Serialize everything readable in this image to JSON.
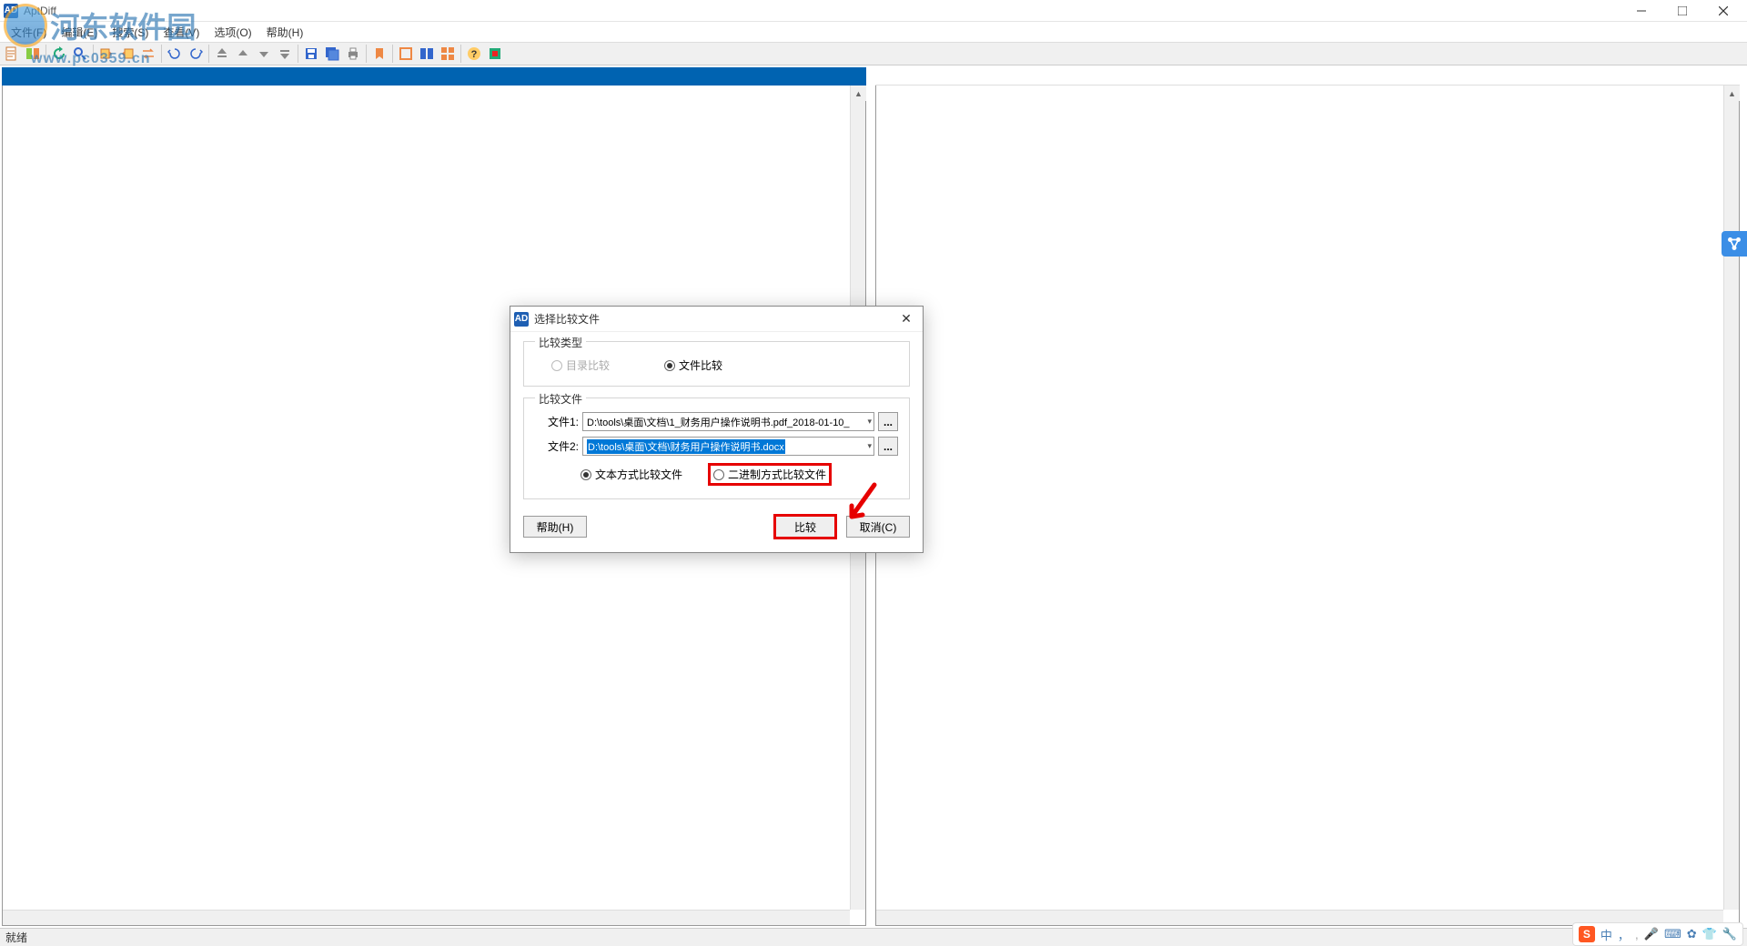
{
  "app": {
    "title": "AptDiff"
  },
  "watermark": {
    "text": "河东软件园",
    "url": "www.pc0359.cn"
  },
  "menu": {
    "file": "文件(F)",
    "edit": "编辑(E)",
    "search": "搜索(S)",
    "view": "查看(V)",
    "options": "选项(O)",
    "help": "帮助(H)"
  },
  "status": {
    "ready": "就绪"
  },
  "dialog": {
    "title": "选择比较文件",
    "compare_type_legend": "比较类型",
    "radio_dir": "目录比较",
    "radio_file": "文件比较",
    "compare_file_legend": "比较文件",
    "file1_label": "文件1:",
    "file2_label": "文件2:",
    "file1_value": "D:\\tools\\桌面\\文档\\1_财务用户操作说明书.pdf_2018-01-10_",
    "file2_value": "D:\\tools\\桌面\\文档\\财务用户操作说明书.docx",
    "radio_text": "文本方式比较文件",
    "radio_binary": "二进制方式比较文件",
    "help_btn": "帮助(H)",
    "compare_btn": "比较",
    "cancel_btn": "取消(C)",
    "browse": "...",
    "close": "✕"
  },
  "ime": {
    "logo": "S",
    "lang": "中",
    "punct": "，",
    "mic": "🎤",
    "kbd": "⌨",
    "settings": "✿",
    "shirt": "👕",
    "tool": "🔧"
  }
}
